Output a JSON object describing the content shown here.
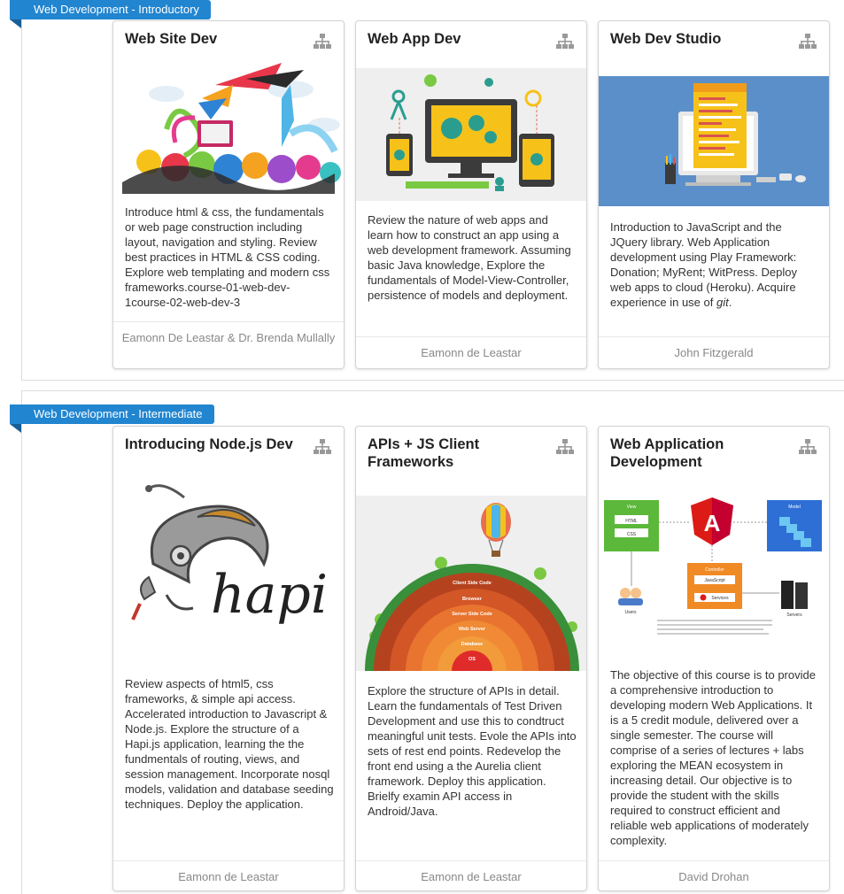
{
  "sections": [
    {
      "label": "Web Development - Introductory"
    },
    {
      "label": "Web Development - Intermediate"
    }
  ],
  "cards": [
    {
      "title": "Web Site Dev",
      "description": "Introduce html & css, the fundamentals or web page construction including layout, navigation and styling. Review best practices in HTML & CSS coding. Explore web templating and modern css frameworks.course-01-web-dev-1course-02-web-dev-3",
      "author": "Eamonn De Leastar & Dr. Brenda Mullally",
      "image": "colorful-creative-art-illustration"
    },
    {
      "title": "Web App Dev",
      "description": "Review the nature of web apps and learn how to construct an app using a web development framework. Assuming basic Java knowledge, Explore the fundamentals of Model-View-Controller, persistence of models and deployment.",
      "author": "Eamonn de Leastar",
      "image": "devices-gears-illustration"
    },
    {
      "title": "Web Dev Studio",
      "description_before": "Introduction to JavaScript and the JQuery library. Web Application development using Play Framework: Donation; MyRent; WitPress. Deploy web apps to cloud (Heroku). Acquire experience in use of ",
      "description_em": "git",
      "description_after": ".",
      "author": "John Fitzgerald",
      "image": "monitor-code-illustration"
    },
    {
      "title": "Introducing Node.js Dev",
      "description": "Review aspects of html5, css frameworks, & simple api access. Accelerated introduction to Javascript & Node.js. Explore the structure of a Hapi.js application, learning the the fundmentals of routing, views, and session management. Incorporate nosql models, validation and database seeding techniques. Deploy the application.",
      "author": "Eamonn de Leastar",
      "image": "hapi-logo",
      "image_text": "hapi"
    },
    {
      "title": "APIs + JS Client Frameworks",
      "description": "Explore the structure of APIs in detail. Learn the fundamentals of Test Driven Development and use this to condtruct meaningful unit tests. Evole the APIs into sets of rest end points. Redevelop the front end using a the Aurelia client framework. Deploy this application. Brielfy examin API access in Android/Java.",
      "author": "Eamonn de Leastar",
      "image": "web-stack-rainbow-illustration",
      "image_layers": [
        "Client Side Code",
        "Browser",
        "Server Side Code",
        "Web Server",
        "Database",
        "OS"
      ]
    },
    {
      "title": "Web Application Development",
      "description": "The objective of this course is to provide a comprehensive introduction to developing modern Web Applications. It is a 5 credit module, delivered over a single semester. The course will comprise of a series of lectures + labs exploring the MEAN ecosystem in increasing detail. Our objective is to provide the student with the skills required to construct efficient and reliable web applications of moderately complexity.",
      "author": "David Drohan",
      "image": "angular-mvc-diagram",
      "diagram": {
        "view": "View",
        "html": "HTML",
        "css": "CSS",
        "model": "Model",
        "controller": "Controller",
        "js": "JavaScript",
        "services": "Services",
        "users": "Users",
        "servers": "Servers",
        "a": "A"
      }
    }
  ],
  "colors": {
    "accent": "#2185d0",
    "accent_dark": "#185e96",
    "icon": "#999999"
  },
  "icons": {
    "card_corner": "sitemap-icon"
  }
}
